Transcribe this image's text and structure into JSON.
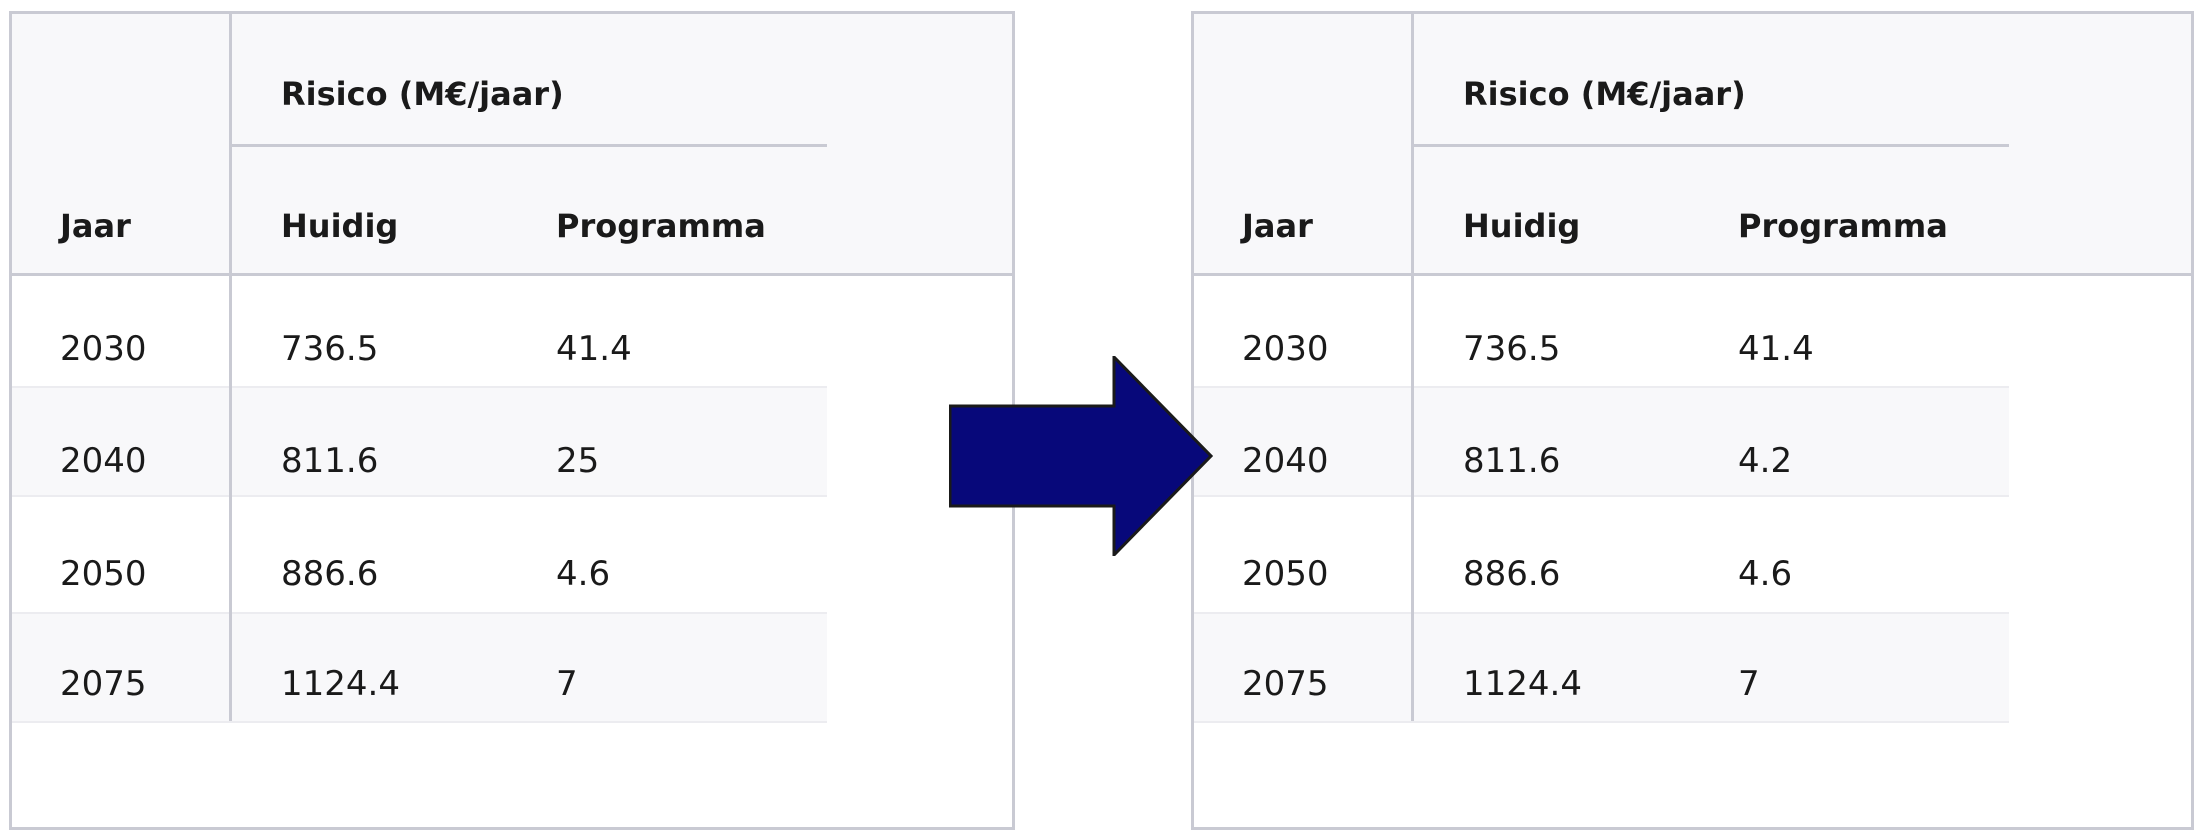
{
  "tables": [
    {
      "group_header": "Risico (M€/jaar)",
      "columns": [
        "Jaar",
        "Huidig",
        "Programma"
      ],
      "rows": [
        [
          "2030",
          "736.5",
          "41.4"
        ],
        [
          "2040",
          "811.6",
          "25"
        ],
        [
          "2050",
          "886.6",
          "4.6"
        ],
        [
          "2075",
          "1124.4",
          "7"
        ]
      ]
    },
    {
      "group_header": "Risico (M€/jaar)",
      "columns": [
        "Jaar",
        "Huidig",
        "Programma"
      ],
      "rows": [
        [
          "2030",
          "736.5",
          "41.4"
        ],
        [
          "2040",
          "811.6",
          "4.2"
        ],
        [
          "2050",
          "886.6",
          "4.6"
        ],
        [
          "2075",
          "1124.4",
          "7"
        ]
      ]
    }
  ],
  "colors": {
    "arrow_fill": "#07087a",
    "border": "#c9cad3",
    "header_bg": "#f8f8fa"
  },
  "icons": {
    "arrow": "right-arrow-icon"
  }
}
